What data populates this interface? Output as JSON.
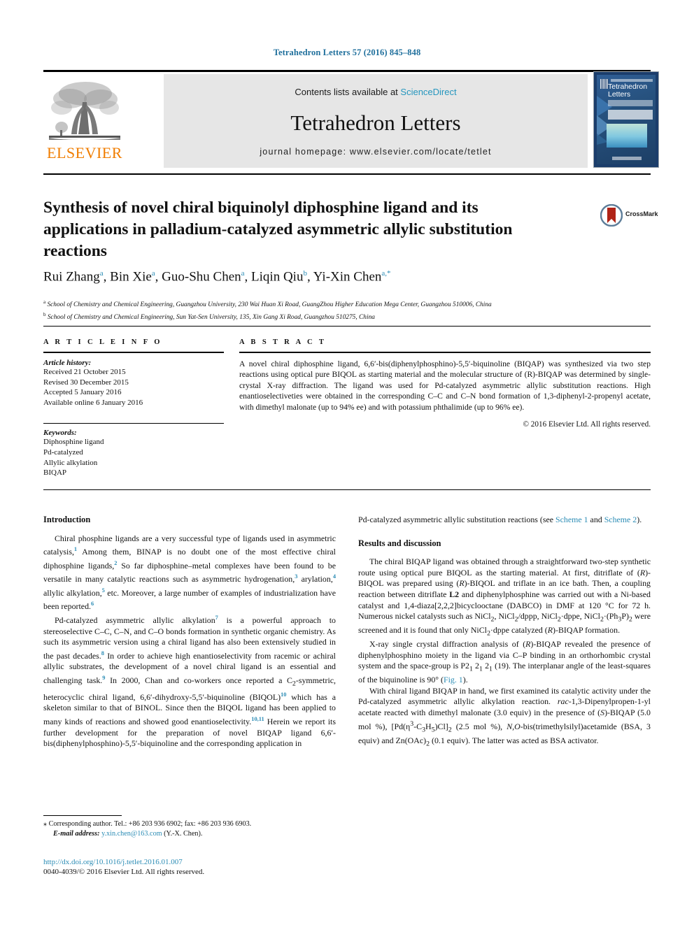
{
  "running_head": "Tetrahedron Letters 57 (2016) 845–848",
  "masthead": {
    "contents_prefix": "Contents lists available at ",
    "sciencedirect": "ScienceDirect",
    "journal_name": "Tetrahedron Letters",
    "homepage": "journal homepage: www.elsevier.com/locate/tetlet",
    "publisher_logo_text": "ELSEVIER",
    "publisher_logo_icon": "elsevier-tree-icon",
    "cover_title": "Tetrahedron Letters",
    "accent_link_color": "#2596be",
    "elsevier_orange": "#f07d00"
  },
  "article": {
    "title": "Synthesis of novel chiral biquinolyl diphosphine ligand and its applications in palladium-catalyzed asymmetric allylic substitution reactions",
    "crossmark_label": "CrossMark",
    "authors_html": "Rui Zhang <sup>a</sup>, Bin Xie <sup>a</sup>, Guo-Shu Chen <sup>a</sup>, Liqin Qiu <sup>b</sup>, Yi-Xin Chen <sup>a,*</sup>",
    "affiliations": [
      "a School of Chemistry and Chemical Engineering, Guangzhou University, 230 Wai Huan Xi Road, GuangZhou Higher Education Mega Center, Guangzhou 510006, China",
      "b School of Chemistry and Chemical Engineering, Sun Yat-Sen University, 135, Xin Gang Xi Road, Guangzhou 510275, China"
    ]
  },
  "article_info": {
    "heading": "A R T I C L E    I N F O",
    "history_label": "Article history:",
    "history": [
      "Received 21 October 2015",
      "Revised 30 December 2015",
      "Accepted 5 January 2016",
      "Available online 6 January 2016"
    ],
    "keywords_label": "Keywords:",
    "keywords": [
      "Diphosphine ligand",
      "Pd-catalyzed",
      "Allylic alkylation",
      "BIQAP"
    ]
  },
  "abstract": {
    "heading": "A B S T R A C T",
    "text": "A novel chiral diphosphine ligand, 6,6′-bis(diphenylphosphino)-5,5′-biquinoline (BIQAP) was synthesized via two step reactions using optical pure BIQOL as starting material and the molecular structure of (R)-BIQAP was determined by single-crystal X-ray diffraction. The ligand was used for Pd-catalyzed asymmetric allylic substitution reactions. High enantioselectiveties were obtained in the corresponding C–C and C–N bond formation of 1,3-diphenyl-2-propenyl acetate, with dimethyl malonate (up to 94% ee) and with potassium phthalimide (up to 96% ee).",
    "copyright": "© 2016 Elsevier Ltd. All rights reserved."
  },
  "body": {
    "left": {
      "intro_heading": "Introduction",
      "p1": "Chiral phosphine ligands are a very successful type of ligands used in asymmetric catalysis,1 Among them, BINAP is no doubt one of the most effective chiral diphosphine ligands,2 So far diphosphine–metal complexes have been found to be versatile in many catalytic reactions such as asymmetric hydrogenation,3 arylation,4 allylic alkylation,5 etc. Moreover, a large number of examples of industrialization have been reported.6",
      "p2": "Pd-catalyzed asymmetric allylic alkylation7 is a powerful approach to stereoselective C–C, C–N, and C–O bonds formation in synthetic organic chemistry. As such its asymmetric version using a chiral ligand has also been extensively studied in the past decades.8 In order to achieve high enantioselectivity from racemic or achiral allylic substrates, the development of a novel chiral ligand is an essential and challenging task.9 In 2000, Chan and co-workers once reported a C2-symmetric, heterocyclic chiral ligand, 6,6′-dihydroxy-5,5′-biquinoline (BIQOL)10 which has a skeleton similar to that of BINOL. Since then the BIQOL ligand has been applied to many kinds of reactions and showed good enantioselectivity.10,11 Herein we report its further development for the preparation of novel BIQAP ligand 6,6′-bis(diphenylphosphino)-5,5′-biquinoline and the corresponding application in"
    },
    "right": {
      "p0_tail": "Pd-catalyzed asymmetric allylic substitution reactions (see Scheme 1 and Scheme 2).",
      "results_heading": "Results and discussion",
      "p1": "The chiral BIQAP ligand was obtained through a straightforward two-step synthetic route using optical pure BIQOL as the starting material. At first, ditriflate of (R)-BIQOL was prepared using (R)-BIQOL and triflate in an ice bath. Then, a coupling reaction between ditriflate L2 and diphenylphosphine was carried out with a Ni-based catalyst and 1,4-diaza[2,2,2]bicyclooctane (DABCO) in DMF at 120 °C for 72 h. Numerous nickel catalysts such as NiCl2, NiCl2/dppp, NiCl2·dppe, NiCl2·(Ph3P)2 were screened and it is found that only NiCl2·dppe catalyzed (R)-BIQAP formation.",
      "p2": "X-ray single crystal diffraction analysis of (R)-BIQAP revealed the presence of diphenylphosphino moiety in the ligand via C–P binding in an orthorhombic crystal system and the space-group is P21 21 21 (19). The interplanar angle of the least-squares of the biquinoline is 90° (Fig. 1).",
      "p3": "With chiral ligand BIQAP in hand, we first examined its catalytic activity under the Pd-catalyzed asymmetric allylic alkylation reaction. rac-1,3-Dipenylpropen-1-yl acetate reacted with dimethyl malonate (3.0 equiv) in the presence of (S)-BIQAP (5.0 mol %), [Pd(η3-C3H5)Cl]2 (2.5 mol %), N,O-bis(trimethylsilyl)acetamide (BSA, 3 equiv) and Zn(OAc)2 (0.1 equiv). The latter was acted as BSA activator.",
      "links": [
        "Scheme 1",
        "Scheme 2",
        "Fig. 1"
      ]
    }
  },
  "footer": {
    "corresponding_marker": "⁎",
    "corresponding": "Corresponding author. Tel.: +86 203 936 6902; fax: +86 203 936 6903.",
    "email_label": "E-mail address:",
    "email": "y.xin.chen@163.com",
    "email_owner": "(Y.-X. Chen).",
    "doi": "http://dx.doi.org/10.1016/j.tetlet.2016.01.007",
    "issn_line": "0040-4039/© 2016 Elsevier Ltd. All rights reserved."
  }
}
